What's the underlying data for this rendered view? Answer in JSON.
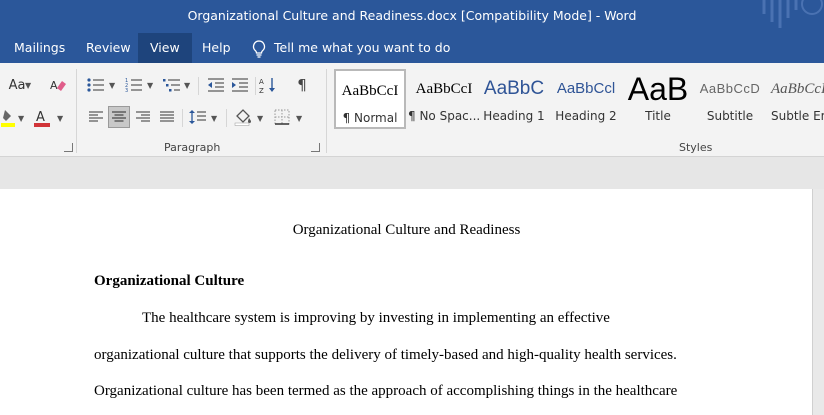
{
  "window": {
    "title": "Organizational Culture and Readiness.docx [Compatibility Mode]  -  Word"
  },
  "menu": {
    "tabs": [
      {
        "label": "Mailings"
      },
      {
        "label": "Review"
      },
      {
        "label": "View"
      },
      {
        "label": "Help"
      }
    ],
    "active_tab": "View",
    "tell_me": "Tell me what you want to do"
  },
  "ribbon": {
    "font": {
      "change_case_label": "Aa",
      "highlight_color": "#ffff00",
      "font_color": "#d13438"
    },
    "paragraph": {
      "group_label": "Paragraph",
      "show_marks_glyph": "¶"
    },
    "styles": {
      "group_label": "Styles",
      "items": [
        {
          "preview": "AaBbCcI",
          "name": "¶ Normal",
          "selected": true
        },
        {
          "preview": "AaBbCcI",
          "name": "¶ No Spac..."
        },
        {
          "preview": "AaBbC",
          "name": "Heading 1"
        },
        {
          "preview": "AaBbCcl",
          "name": "Heading 2"
        },
        {
          "preview": "AaB",
          "name": "Title"
        },
        {
          "preview": "AaBbCcD",
          "name": "Subtitle"
        },
        {
          "preview": "AaBbCcI",
          "name": "Subtle Em"
        }
      ]
    }
  },
  "document": {
    "title": "Organizational Culture and Readiness",
    "heading": "Organizational Culture",
    "lines": [
      "The healthcare system is improving by investing in implementing an effective",
      "organizational culture that supports the delivery of timely-based and high-quality health services.",
      "Organizational culture has been termed as the approach of accomplishing things in the healthcare"
    ]
  },
  "colors": {
    "brand": "#2b579a",
    "active_tab": "#1e447c",
    "heading_blue": "#2f5496"
  }
}
